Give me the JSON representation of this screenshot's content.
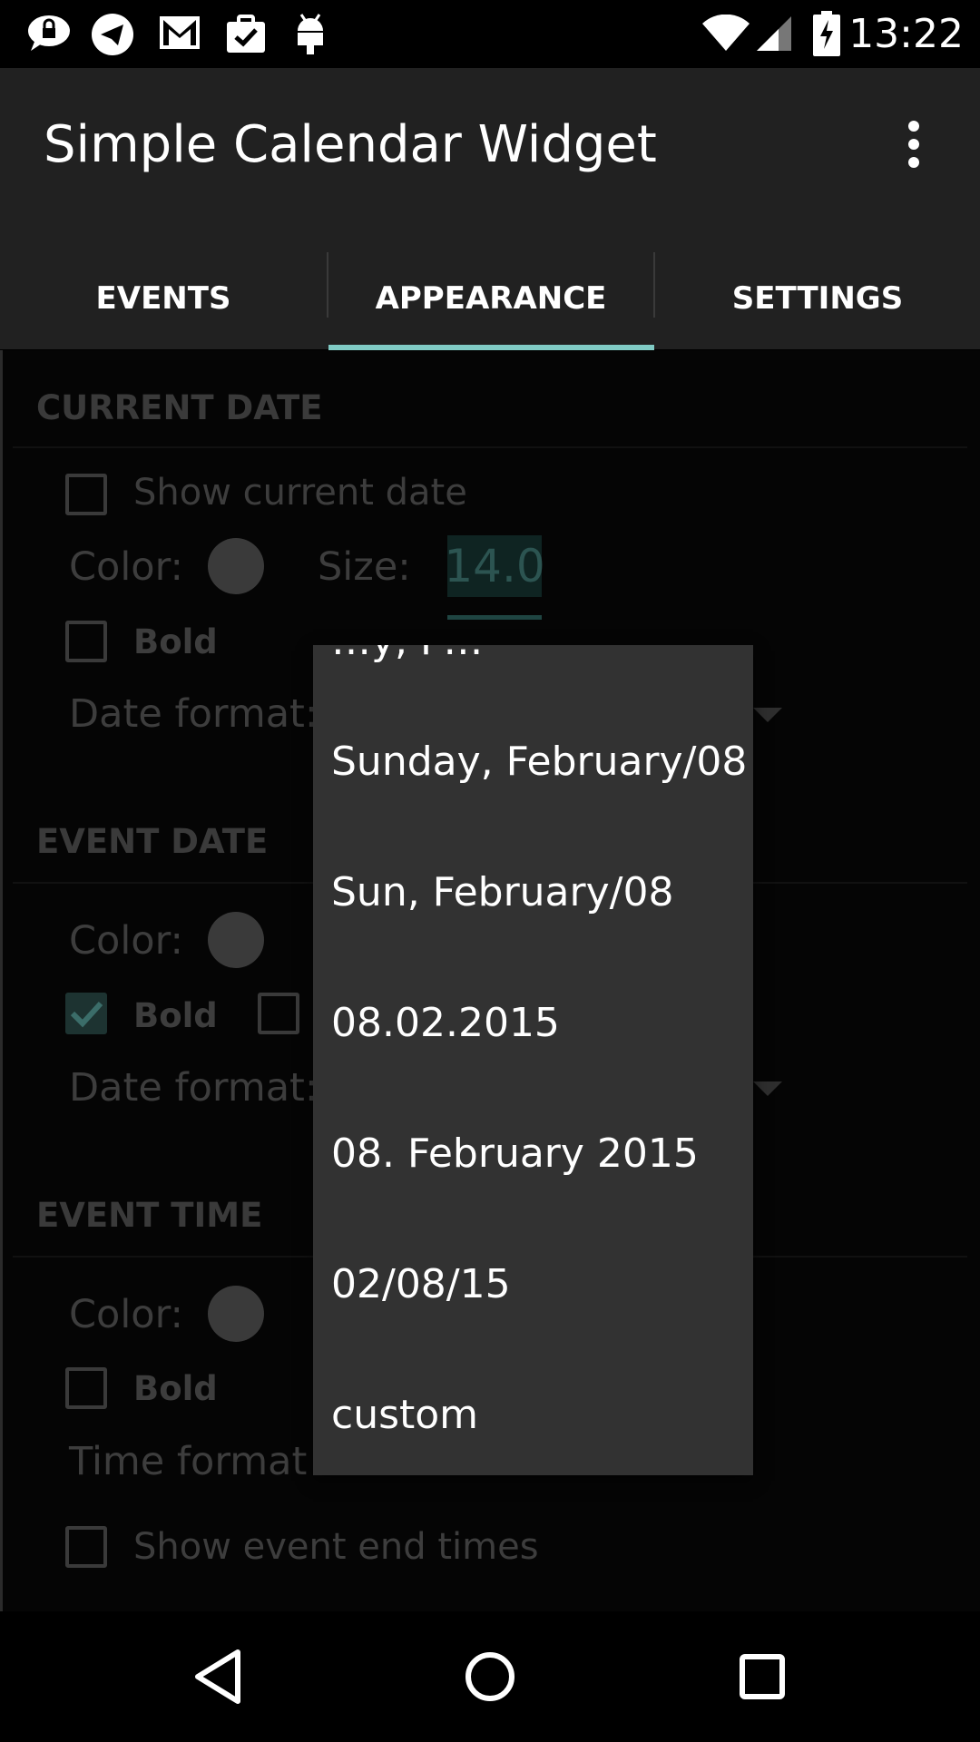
{
  "status_bar": {
    "time": "13:22",
    "left_icons": [
      "lock-chat-icon",
      "telegram-icon",
      "gmail-icon",
      "task-check-icon",
      "android-icon"
    ],
    "right_icons": [
      "wifi-icon",
      "signal-icon",
      "battery-charging-icon"
    ]
  },
  "app_bar": {
    "title": "Simple Calendar Widget",
    "menu_icon": "overflow-menu-icon"
  },
  "tabs": [
    {
      "label": "EVENTS",
      "selected": false
    },
    {
      "label": "APPEARANCE",
      "selected": true
    },
    {
      "label": "SETTINGS",
      "selected": false
    }
  ],
  "sections": {
    "current_date": {
      "header": "CURRENT DATE",
      "show_label": "Show current date",
      "color_label": "Color:",
      "size_label": "Size:",
      "size_value": "14.0",
      "bold_label": "Bold",
      "date_format_label": "Date format:"
    },
    "event_date": {
      "header": "EVENT DATE",
      "color_label": "Color:",
      "bold_label": "Bold",
      "bold_checked": true,
      "date_format_label": "Date format:"
    },
    "event_time": {
      "header": "EVENT TIME",
      "color_label": "Color:",
      "bold_label": "Bold",
      "time_format_label": "Time format",
      "show_end_times_label": "Show event end times"
    }
  },
  "dropdown": {
    "partial_item": "…y, F…",
    "items": [
      "Sunday, February/08",
      "Sun, February/08",
      "08.02.2015",
      "08. February 2015",
      "02/08/15",
      "custom"
    ]
  },
  "nav_bar": {
    "buttons": [
      "back-icon",
      "home-icon",
      "recents-icon"
    ]
  },
  "colors": {
    "tab_indicator": "#80cbc4",
    "app_bar_bg": "#212121",
    "dropdown_bg": "#323232"
  }
}
